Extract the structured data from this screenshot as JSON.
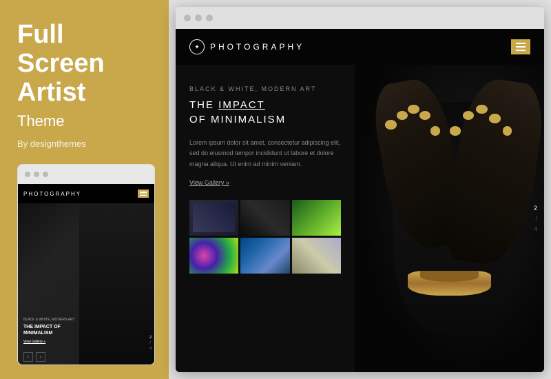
{
  "left": {
    "title": "Full\nScreen\nArtist",
    "subtitle": "Theme",
    "byline": "By designthemes",
    "mini_preview": {
      "dots": [
        "dot1",
        "dot2",
        "dot3"
      ],
      "logo": "PhOTOGRAPHY",
      "article_label": "black & white, modern art",
      "article_title": "THE IMPACT OF MINIMALISM",
      "view_gallery": "View Gallery »",
      "page_nums": [
        "2",
        "/",
        "4"
      ],
      "arrows": [
        "‹",
        "›"
      ]
    }
  },
  "browser": {
    "dots": [
      "dot1",
      "dot2",
      "dot3"
    ],
    "header": {
      "logo_text": "PhOTOGRAPHY",
      "hamburger_label": "menu"
    },
    "content": {
      "article_label": "black & white, modern art",
      "article_title_part1": "THE",
      "article_title_underline": "IMPACT",
      "article_title_part2": "OF MINIMALISM",
      "article_body": "Lorem ipsum dolor sit amet, consectetur adipiscing elit, sed do eiusmod tempor incididunt ut labore et dolore magna aliqua. Ut enim ad minim veniam.",
      "view_gallery_link": "View Gallery »"
    },
    "gallery": {
      "thumbnails": [
        {
          "id": "thumb-1",
          "alt": "gallery image 1"
        },
        {
          "id": "thumb-2",
          "alt": "gallery image 2"
        },
        {
          "id": "thumb-3",
          "alt": "gallery image 3"
        },
        {
          "id": "thumb-4",
          "alt": "gallery image 4"
        },
        {
          "id": "thumb-5",
          "alt": "gallery image 5"
        },
        {
          "id": "thumb-6",
          "alt": "gallery image 6"
        }
      ]
    },
    "pagination": {
      "items": [
        "2",
        "/",
        "4"
      ]
    }
  },
  "colors": {
    "gold": "#c9a84c",
    "dark_bg": "#0a0a0a",
    "panel_bg": "#c9a84c",
    "white": "#ffffff"
  }
}
